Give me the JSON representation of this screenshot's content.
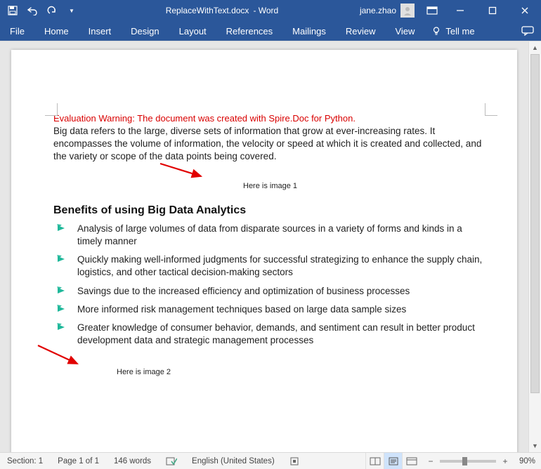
{
  "title": {
    "filename": "ReplaceWithText.docx",
    "appsuffix": "- Word"
  },
  "user": {
    "name": "jane.zhao"
  },
  "ribbon": {
    "tabs": [
      "File",
      "Home",
      "Insert",
      "Design",
      "Layout",
      "References",
      "Mailings",
      "Review",
      "View"
    ],
    "tellme": "Tell me"
  },
  "doc": {
    "warning": "Evaluation Warning: The document was created with Spire.Doc for Python.",
    "intro": "Big data refers to the large, diverse sets of information that grow at ever-increasing rates. It encompasses the volume of information, the velocity or speed at which it is created and collected, and the variety or scope of the data points being covered.",
    "img1": "Here is image 1",
    "heading": "Benefits of using Big Data Analytics",
    "bullets": [
      "Analysis of large volumes of data from disparate sources in a variety of forms and kinds in a timely manner",
      "Quickly making well-informed judgments for successful strategizing to enhance the supply chain, logistics, and other tactical decision-making sectors",
      "Savings due to the increased efficiency and optimization of business processes",
      "More informed risk management techniques based on large data sample sizes",
      "Greater knowledge of consumer behavior, demands, and sentiment can result in better product development data and strategic management processes"
    ],
    "img2": "Here is image 2"
  },
  "status": {
    "section": "Section: 1",
    "page": "Page 1 of 1",
    "words": "146 words",
    "language": "English (United States)",
    "zoom": "90%"
  }
}
